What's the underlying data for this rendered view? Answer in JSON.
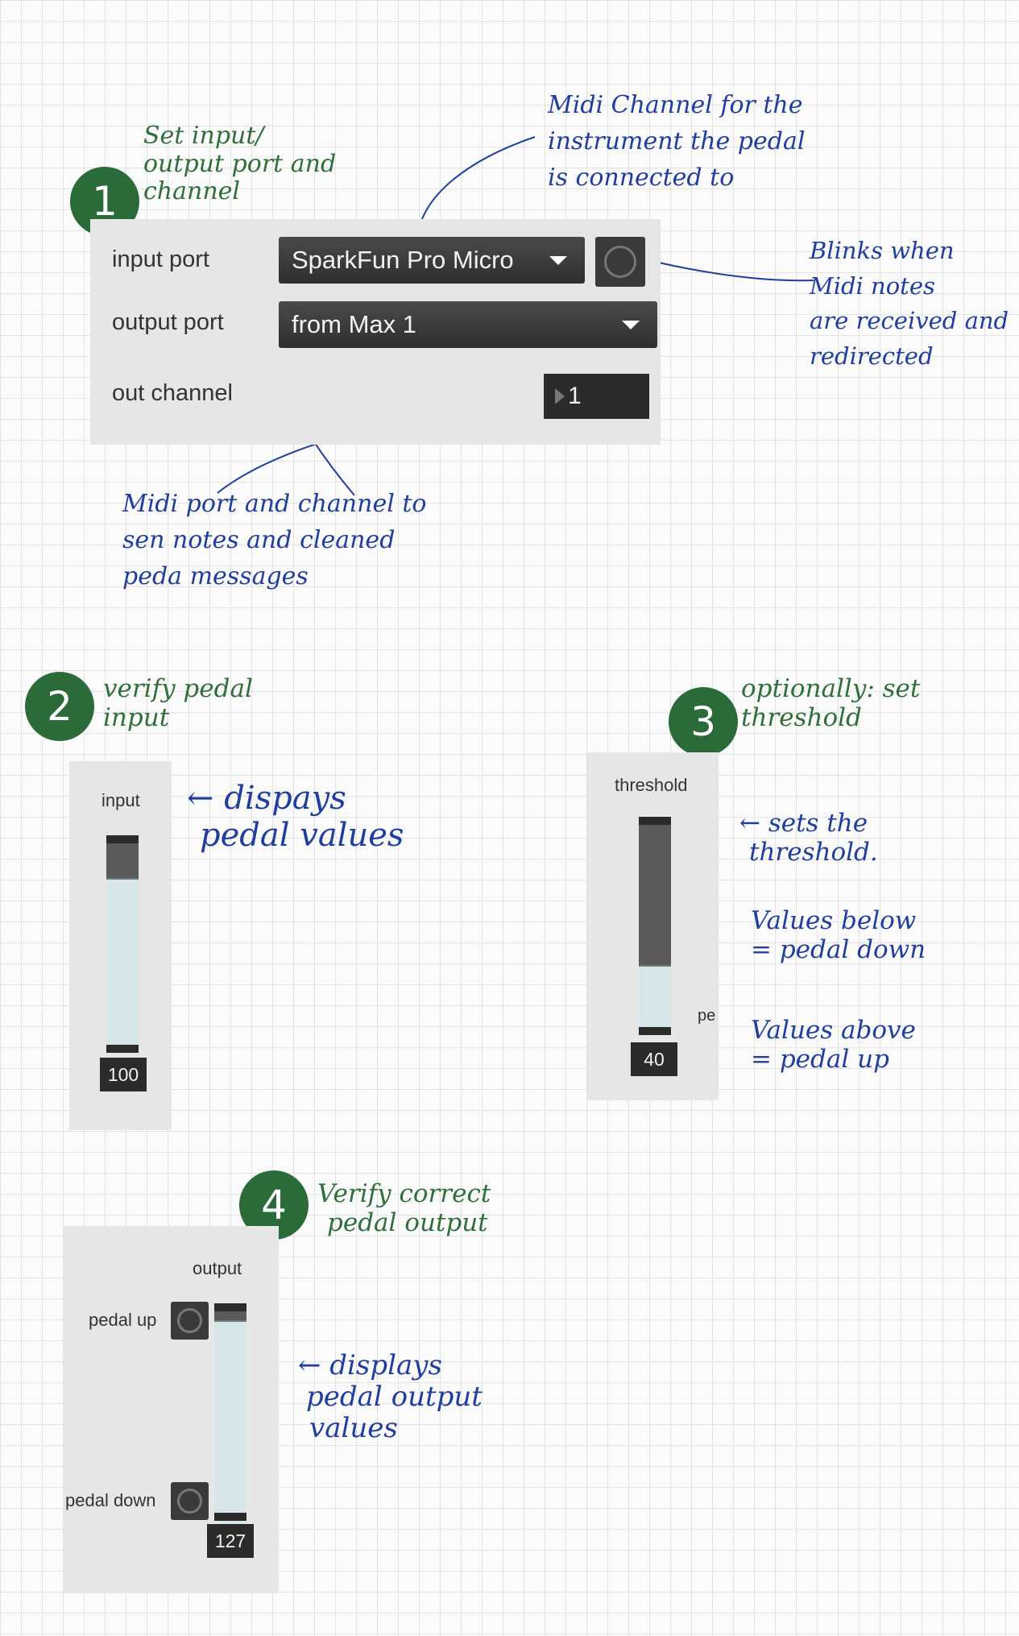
{
  "midi_panel": {
    "input_port_label": "input port",
    "input_port_value": "SparkFun Pro Micro",
    "output_port_label": "output port",
    "output_port_value": "from Max 1",
    "out_channel_label": "out channel",
    "out_channel_value": "1"
  },
  "input_panel": {
    "label": "input",
    "value": "100",
    "level": 0.82
  },
  "threshold_panel": {
    "label": "threshold",
    "value": "40",
    "level": 0.3,
    "side_text": "pe"
  },
  "output_panel": {
    "label": "output",
    "pedal_up_label": "pedal up",
    "pedal_down_label": "pedal down",
    "value": "127",
    "level": 0.95
  },
  "steps": [
    "1",
    "2",
    "3",
    "4"
  ],
  "annotations": {
    "step1": [
      "Set input/",
      "output port and",
      "channel"
    ],
    "midi_channel": [
      "Midi Channel for the",
      "instrument the pedal",
      "is connected to"
    ],
    "blinks": [
      "Blinks when",
      "Midi notes",
      "are received and",
      "redirected"
    ],
    "midi_port": [
      "Midi port and channel to",
      "sen notes and cleaned",
      "peda messages"
    ],
    "step2": [
      "verify pedal",
      "input"
    ],
    "displays_input": [
      "← dispays",
      "pedal values"
    ],
    "step3": [
      "optionally: set",
      "threshold"
    ],
    "sets_threshold": [
      "← sets the",
      "threshold."
    ],
    "values_below": [
      "Values below",
      "= pedal down"
    ],
    "values_above": [
      "Values above",
      "= pedal up"
    ],
    "step4": [
      "Verify correct",
      "pedal output"
    ],
    "displays_output": [
      "← displays",
      "pedal output",
      "values"
    ]
  },
  "colors": {
    "panel": "#e6e6e6",
    "annotation_green": "#2e6f3a",
    "annotation_blue": "#1f3ea0",
    "badge": "#2b6a39"
  }
}
